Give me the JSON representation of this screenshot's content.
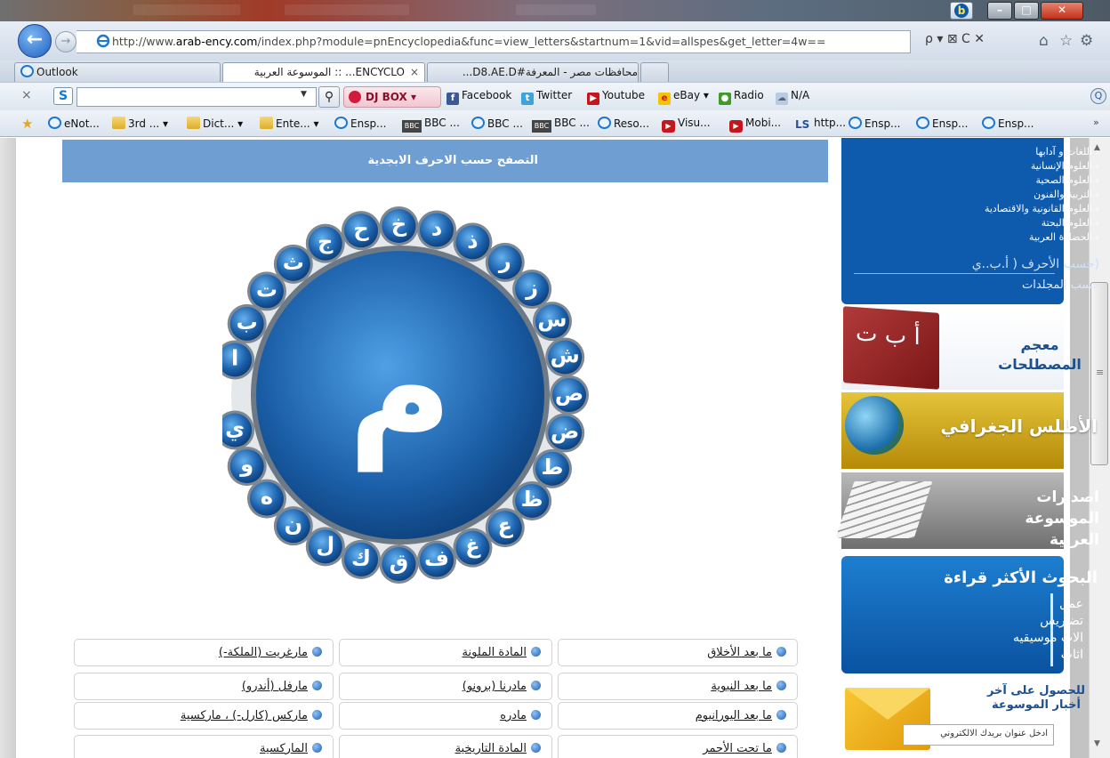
{
  "browser": {
    "url_prefix": "http://www.",
    "url_domain": "arab-ency.com",
    "url_rest": "/index.php?module=pnEncyclopedia&func=view_letters&startnum=1&vid=allspes&get_letter=4w==",
    "url_tools": "ρ ▾ ⊠ C ✕",
    "tabs": [
      "Outlook",
      "ENCYCLO... :: الموسوعة العربية",
      "محافظات مصر - المعرفة#D8.AE.D..."
    ],
    "tab_close": "×"
  },
  "toolbar": {
    "close": "×",
    "search_placeholder": "",
    "djbox": "DJ BOX ▾",
    "facebook": "Facebook",
    "twitter": "Twitter",
    "youtube": "Youtube",
    "ebay": "eBay ▾",
    "radio": "Radio",
    "weather": "N/A"
  },
  "favorites": [
    "eNot...",
    "3rd ... ▾",
    "Dict... ▾",
    "Ente... ▾",
    "Ensp...",
    "BBC ...",
    "BBC ...",
    "BBC ...",
    "Reso...",
    "Visu...",
    "Mobi...",
    "http...",
    "Ensp...",
    "Ensp...",
    "Ensp..."
  ],
  "sidebar": {
    "categories": [
      "اللغات و آدابها",
      "العلوم الإنسانية",
      "العلوم الصحية",
      "التربية والفنون",
      "العلوم القانونية والاقتصادية",
      "العلوم البحتة",
      "الحضارة العربية"
    ],
    "by_letters": "(حسب الأحرف ( أ.ب..ي",
    "by_volumes": "حسب المجلدات",
    "terms_book": "أ ب ت",
    "terms": "معجم المصطلحات",
    "atlas": "الأطلس الجغرافي",
    "publications": "اصدارات الموسوعة العربية",
    "most_read_title": "البحوث الأكثر قراءة",
    "most_read": [
      "عمل",
      "تضاريس",
      "الات موسيقيه",
      "اثاث"
    ],
    "news_text": "للحصول على آخر أخبار الموسوعة",
    "email_placeholder": "ادخل عنوان بريدك الالكتروني"
  },
  "main": {
    "header": "التصفح حسب الاحرف الابجدية",
    "selected_letter": "م",
    "letters": [
      "ا",
      "ب",
      "ت",
      "ث",
      "ج",
      "ح",
      "خ",
      "د",
      "ذ",
      "ر",
      "ز",
      "س",
      "ش",
      "ص",
      "ض",
      "ط",
      "ظ",
      "ع",
      "غ",
      "ف",
      "ق",
      "ك",
      "ل",
      "ن",
      "ه",
      "و",
      "ي"
    ]
  },
  "results": [
    [
      "ما بعد الأخلاق",
      "المادة الملونة",
      "مارغريت (الملكة-)"
    ],
    [
      "ما بعد النبوية",
      "مادرنا (برونو)",
      "مارفل (أندرو)"
    ],
    [
      "ما بعد اليورانيوم",
      "مادره",
      "ماركس (كارل-) ، ماركسية"
    ],
    [
      "ما تحت الأحمر",
      "المادة التاريخية",
      "الماركسية"
    ]
  ],
  "colors": {
    "header_blue": "#6f9ed3",
    "sidebar_blue": "#0e5aad",
    "letter_disc": "#1b5fa8"
  }
}
